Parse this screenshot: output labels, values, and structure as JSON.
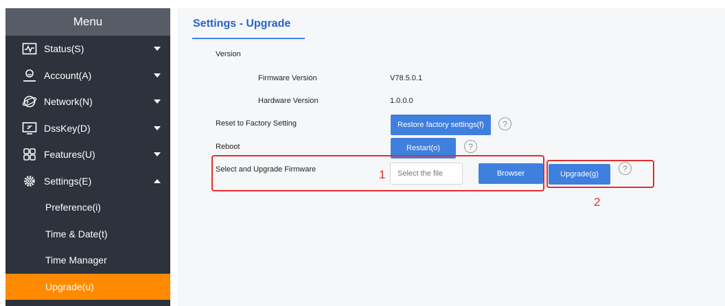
{
  "sidebar": {
    "header": "Menu",
    "items": [
      {
        "label": "Status(S)",
        "icon": "status-icon",
        "expanded": false
      },
      {
        "label": "Account(A)",
        "icon": "account-icon",
        "expanded": false
      },
      {
        "label": "Network(N)",
        "icon": "network-icon",
        "expanded": false
      },
      {
        "label": "DssKey(D)",
        "icon": "dsskey-icon",
        "expanded": false
      },
      {
        "label": "Features(U)",
        "icon": "features-icon",
        "expanded": false
      },
      {
        "label": "Settings(E)",
        "icon": "settings-icon",
        "expanded": true
      }
    ],
    "subitems": [
      {
        "label": "Preference(i)",
        "active": false
      },
      {
        "label": "Time & Date(t)",
        "active": false
      },
      {
        "label": "Time Manager",
        "active": false
      },
      {
        "label": "Upgrade(u)",
        "active": true
      }
    ]
  },
  "main": {
    "title": "Settings - Upgrade",
    "version_label": "Version",
    "firmware_label": "Firmware Version",
    "firmware_value": "V78.5.0.1",
    "hardware_label": "Hardware Version",
    "hardware_value": "1.0.0.0",
    "reset_label": "Reset to Factory Setting",
    "restore_button": "Restore factory settings(f)",
    "reboot_label": "Reboot",
    "restart_button": "Restart(o)",
    "upgrade_label": "Select and Upgrade Firmware",
    "file_placeholder": "Select the file",
    "browser_button": "Browser",
    "upgrade_button": "Upgrade(g)",
    "help_glyph": "?"
  },
  "annotations": {
    "marker1": "1",
    "marker2": "2",
    "color": "#e32c2c"
  },
  "colors": {
    "accent": "#3f7fde",
    "active": "#ff8a00",
    "sidebar": "#2d323c",
    "title": "#2563c9"
  }
}
